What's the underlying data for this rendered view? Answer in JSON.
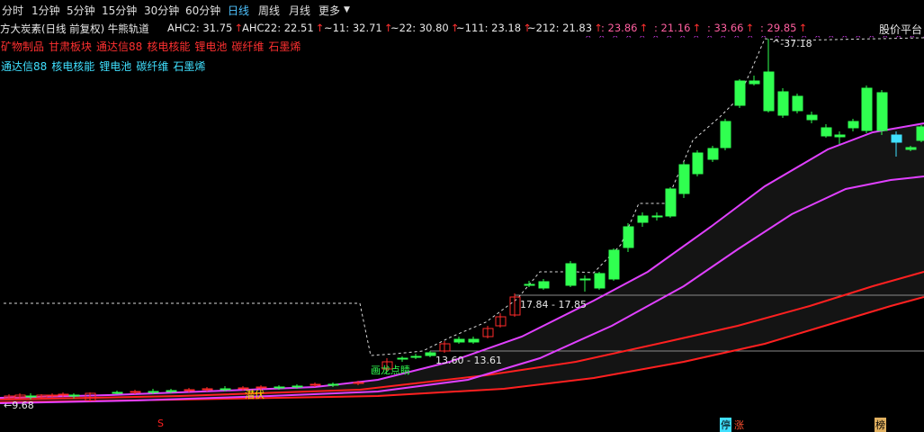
{
  "toolbar": {
    "tabs": [
      "分时",
      "1分钟",
      "5分钟",
      "15分钟",
      "30分钟",
      "60分钟",
      "日线",
      "周线",
      "月线",
      "更多"
    ],
    "active_tab": "日线",
    "more_label": "更多"
  },
  "header": {
    "title": "方大炭素(日线 前复权) 牛熊轨道",
    "indicators": [
      {
        "name": "AHC2",
        "value": "31.75"
      },
      {
        "name": "AHC22",
        "value": "22.51"
      },
      {
        "name": "~11",
        "value": "32.71"
      },
      {
        "name": "~22",
        "value": "30.80"
      },
      {
        "name": "~111",
        "value": "23.18"
      },
      {
        "name": "~212",
        "value": "21.83"
      }
    ],
    "extra_values": [
      "23.86",
      "21.16",
      "33.66",
      "29.85"
    ],
    "price_platform_label": "股价平台"
  },
  "tags": {
    "row1": [
      "矿物制品",
      "甘肃板块",
      "通达信88",
      "核电核能",
      "锂电池",
      "碳纤维",
      "石墨烯"
    ],
    "row2": [
      "通达信88",
      "核电核能",
      "锂电池",
      "碳纤维",
      "石墨烯"
    ]
  },
  "chart_labels": {
    "high_label": "37.18",
    "range1": "17.84 - 17.85",
    "range2": "13.60 - 13.61",
    "low_label": "9.68",
    "start_signal": "画龙点睛",
    "lurk_signal": "潜伏"
  },
  "footer_markers": {
    "red_s": "S",
    "stop": "停",
    "rise": "涨",
    "list": "榜"
  },
  "colors": {
    "up": "#ff2a2a",
    "down": "#30ff50",
    "magenta": "#e040ff",
    "red_line": "#ff2020",
    "bg": "#000000"
  },
  "chart_data": {
    "type": "candlestick",
    "indicator": "牛熊轨道",
    "annotations": {
      "high": 37.18,
      "low": 9.68,
      "platform_levels": [
        17.85,
        13.61
      ]
    }
  }
}
